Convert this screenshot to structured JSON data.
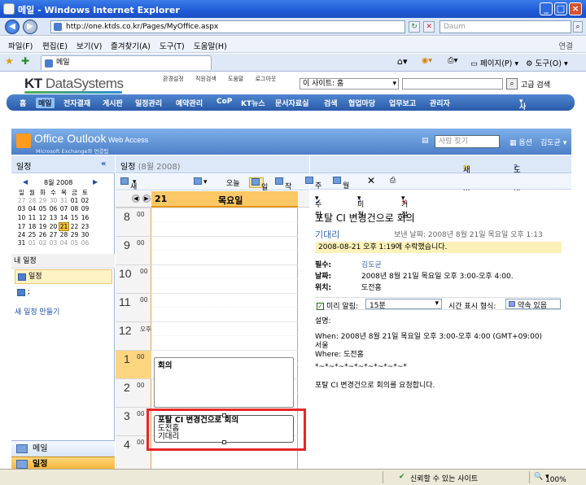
{
  "window": {
    "title": "메일 - Windows Internet Explorer"
  },
  "address": {
    "url": "http://one.ktds.co.kr/Pages/MyOffice.aspx",
    "search_placeholder": "Daum"
  },
  "menu": {
    "items": [
      "파일(F)",
      "편집(E)",
      "보기(V)",
      "즐겨찾기(A)",
      "도구(T)",
      "도움말(H)"
    ],
    "link": "연결"
  },
  "tabrow": {
    "tab_title": "메일",
    "page": "페이지(P)",
    "tools": "도구(O)"
  },
  "portal": {
    "logo_prefix": "KT",
    "logo_text": "DataSystems",
    "top_links": [
      "환경설정",
      "직원검색",
      "도움말",
      "로그아웃"
    ],
    "site_select": "이 사이트: 홈",
    "advanced_search": "고급 검색",
    "nav": [
      "홈",
      "메일",
      "전자결재",
      "게시판",
      "일정관리",
      "예약관리",
      "CoP",
      "KT뉴스",
      "문서자료실",
      "검색",
      "협업마당",
      "업무보고",
      "관리자"
    ],
    "site_action": "사이트 작업"
  },
  "owa": {
    "title": "Office Outlook",
    "title_small": " Web Access",
    "subtitle": "Microsoft Exchange와 연결됨",
    "people_search": "사람 찾기",
    "options": "옵션",
    "user": "김도균"
  },
  "left": {
    "header": "일정",
    "minical": {
      "month": "8월 2008",
      "weekdays": [
        "일",
        "월",
        "화",
        "수",
        "목",
        "금",
        "토"
      ],
      "weeks": [
        [
          "27",
          "28",
          "29",
          "30",
          "31",
          "01",
          "02"
        ],
        [
          "03",
          "04",
          "05",
          "06",
          "07",
          "08",
          "09"
        ],
        [
          "10",
          "11",
          "12",
          "13",
          "14",
          "15",
          "16"
        ],
        [
          "17",
          "18",
          "19",
          "20",
          "21",
          "22",
          "23"
        ],
        [
          "24",
          "25",
          "26",
          "27",
          "28",
          "29",
          "30"
        ],
        [
          "31",
          "01",
          "02",
          "03",
          "04",
          "05",
          "06"
        ]
      ],
      "today": "21"
    },
    "my_calendars": "내 일정",
    "calendar_item": "일정",
    "calendar_item2": ";",
    "new_calendar": "새 일정 만들기",
    "nav_mail": "메일",
    "nav_calendar": "일정"
  },
  "center": {
    "title": "일정",
    "title_date": "(8월 2008)",
    "toolbar": {
      "new": "새로 만들기",
      "today": "오늘",
      "day": "일",
      "workweek": "작업 주",
      "week": "주",
      "month": "월"
    },
    "day_num": "21",
    "day_name": "목요일",
    "hours": [
      {
        "h": "8",
        "s": "00"
      },
      {
        "h": "9",
        "s": "00"
      },
      {
        "h": "10",
        "s": "00"
      },
      {
        "h": "11",
        "s": "00"
      },
      {
        "h": "12",
        "s": "오후"
      },
      {
        "h": "1",
        "s": "00"
      },
      {
        "h": "2",
        "s": "00"
      },
      {
        "h": "3",
        "s": "00"
      },
      {
        "h": "4",
        "s": "00"
      }
    ],
    "appt1": {
      "title": "회의"
    },
    "appt2": {
      "title": "포탈 CI 변경건으로 회의",
      "location": "도전홈",
      "organizer": "기대리"
    }
  },
  "reading": {
    "new_mail": "새 메일",
    "help": "도움말",
    "accept": "수락",
    "tentative": "미정",
    "decline": "거절",
    "subject": "포탈 CI 변경건으로 회의",
    "from": "기대리",
    "sent": "보낸 날짜: 2008년 8월 21일 목요일 오후 1:13",
    "info": "2008-08-21 오후 1:19에 수락했습니다.",
    "required_label": "필수:",
    "required": "김도균",
    "when_label": "날짜:",
    "when": "2008년 8월 21일 목요일 오후 3:00-오후 4:00.",
    "where_label": "위치:",
    "where": "도전홈",
    "reminder_label": "미리 알림:",
    "reminder": "15분",
    "showas_label": "시간 표시 형식:",
    "showas": "약속 있음",
    "desc_label": "설명:",
    "desc_when": "When: 2008년 8월 21일 목요일 오후 3:00-오후 4:00 (GMT+09:00)",
    "desc_when2": "서울",
    "desc_where": "Where: 도전홈",
    "desc_sep": "*~*~*~*~*~*~*~*~*~*",
    "desc_body": "포탈 CI 변경건으로 회의를 요청합니다."
  },
  "status": {
    "zone": "신뢰할 수 있는 사이트",
    "zoom": "100%"
  }
}
